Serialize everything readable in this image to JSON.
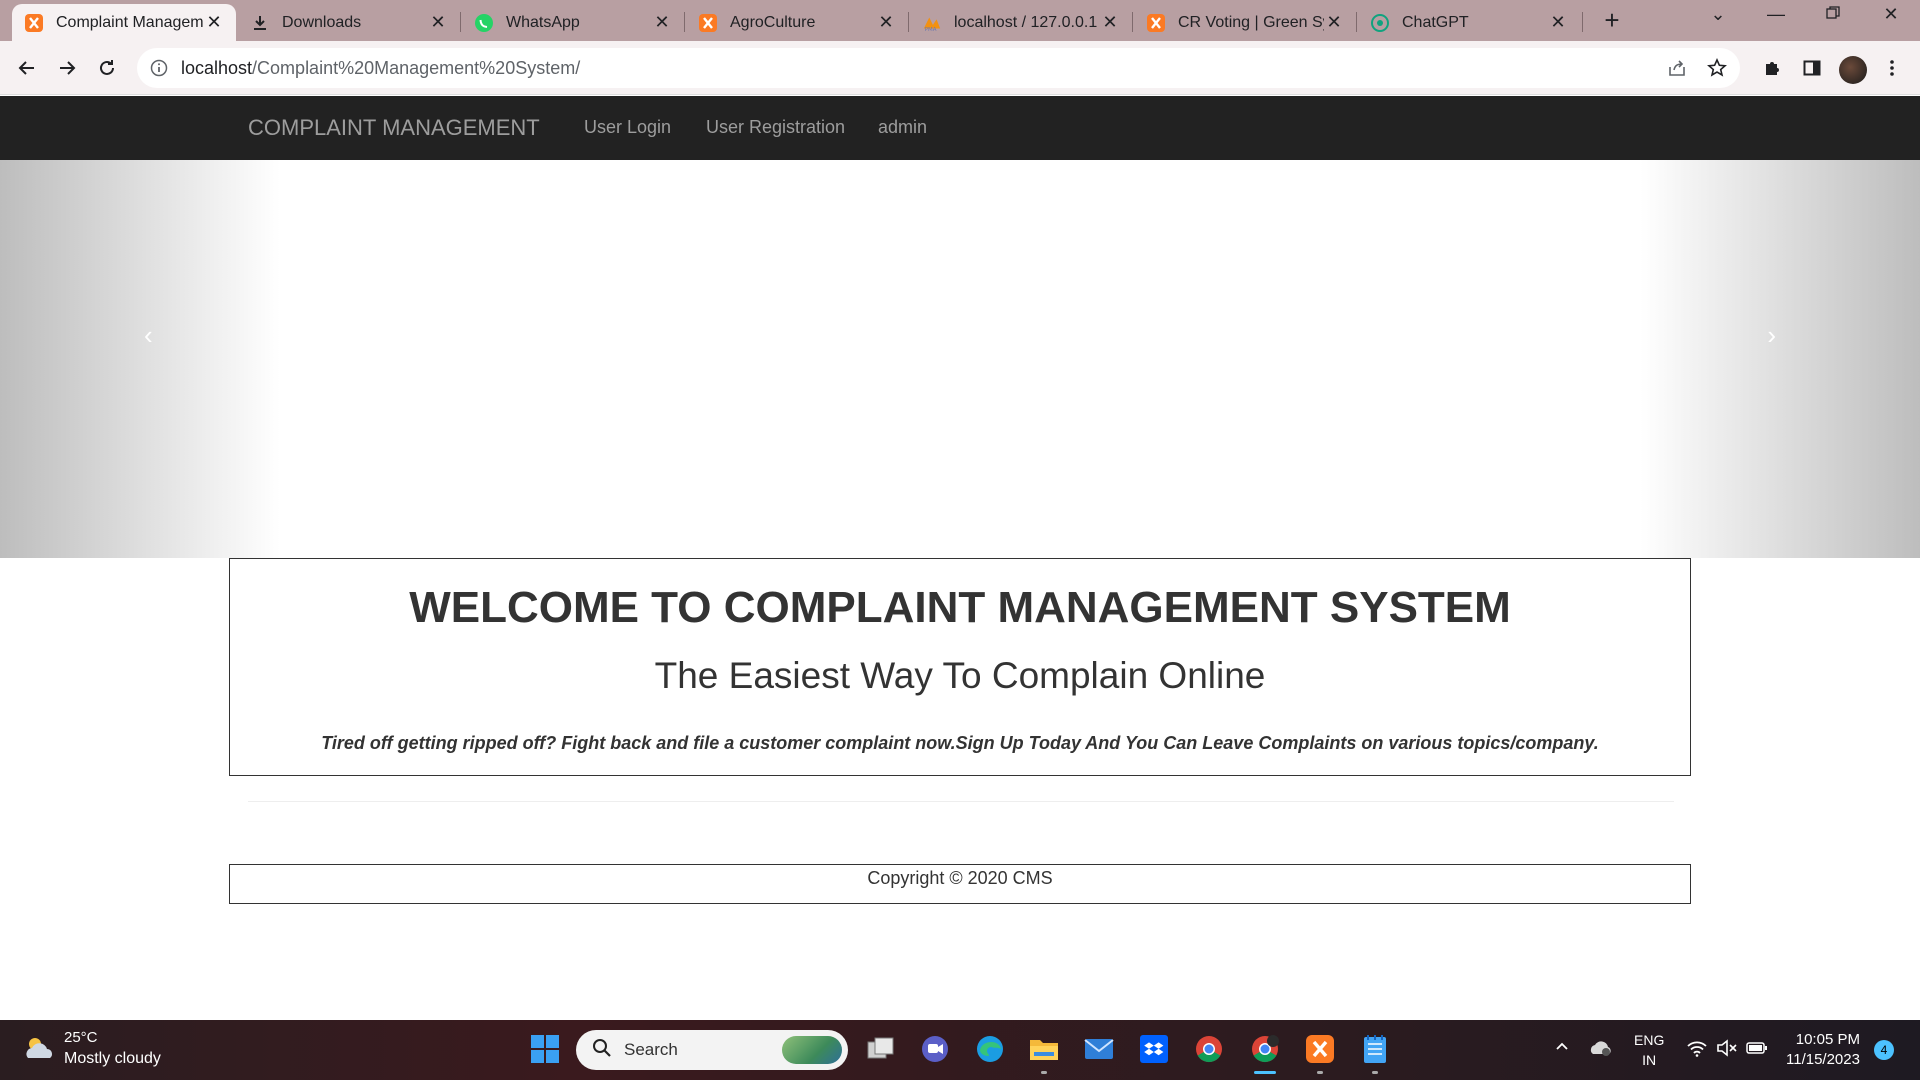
{
  "browser": {
    "tabs": [
      {
        "title": "Complaint Managem",
        "icon": "xampp-icon",
        "active": true
      },
      {
        "title": "Downloads",
        "icon": "download-icon",
        "active": false
      },
      {
        "title": "WhatsApp",
        "icon": "whatsapp-icon",
        "active": false
      },
      {
        "title": "AgroCulture",
        "icon": "xampp-icon",
        "active": false
      },
      {
        "title": "localhost / 127.0.0.1 |",
        "icon": "phpmyadmin-icon",
        "active": false
      },
      {
        "title": "CR Voting | Green Sy",
        "icon": "xampp-icon",
        "active": false
      },
      {
        "title": "ChatGPT",
        "icon": "chatgpt-icon",
        "active": false
      }
    ],
    "url_host": "localhost",
    "url_path": "/Complaint%20Management%20System/"
  },
  "site": {
    "brand": "COMPLAINT MANAGEMENT",
    "nav": [
      "User Login",
      "User Registration",
      "admin"
    ],
    "carousel": {
      "prev": "‹",
      "next": "›"
    },
    "welcome": {
      "heading": "WELCOME TO COMPLAINT MANAGEMENT SYSTEM",
      "subheading": "The Easiest Way To Complain Online",
      "tagline": "Tired off getting ripped off? Fight back and file a customer complaint now.Sign Up Today And You Can Leave Complaints on various topics/company."
    },
    "footer": "Copyright © 2020 CMS"
  },
  "taskbar": {
    "weather_temp": "25°C",
    "weather_desc": "Mostly cloudy",
    "search_placeholder": "Search",
    "lang_line1": "ENG",
    "lang_line2": "IN",
    "time": "10:05 PM",
    "date": "11/15/2023",
    "notification_count": "4"
  },
  "colors": {
    "tabbar": "#b89fa2",
    "navbar": "#222222",
    "nav_text": "#9d9d9d",
    "accent": "#4cc2ff"
  }
}
